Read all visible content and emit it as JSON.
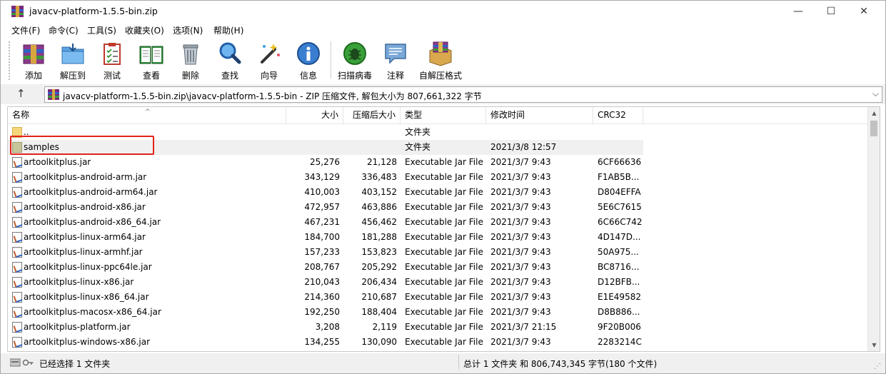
{
  "window": {
    "title": "javacv-platform-1.5.5-bin.zip",
    "minimize_glyph": "—",
    "maximize_glyph": "☐",
    "close_glyph": "✕"
  },
  "menu": [
    {
      "label": "文件(F)"
    },
    {
      "label": "命令(C)"
    },
    {
      "label": "工具(S)"
    },
    {
      "label": "收藏夹(O)"
    },
    {
      "label": "选项(N)"
    },
    {
      "label": "帮助(H)"
    }
  ],
  "toolbar": [
    {
      "label": "添加",
      "icon": "add-archive-icon"
    },
    {
      "label": "解压到",
      "icon": "extract-folder-icon"
    },
    {
      "label": "测试",
      "icon": "test-clipboard-icon"
    },
    {
      "label": "查看",
      "icon": "view-book-icon"
    },
    {
      "label": "删除",
      "icon": "trash-icon"
    },
    {
      "label": "查找",
      "icon": "magnifier-icon"
    },
    {
      "label": "向导",
      "icon": "wizard-wand-icon"
    },
    {
      "label": "信息",
      "icon": "info-icon"
    },
    {
      "label": "扫描病毒",
      "icon": "virus-scan-icon"
    },
    {
      "label": "注释",
      "icon": "comment-icon"
    },
    {
      "label": "自解压格式",
      "icon": "sfx-box-icon"
    }
  ],
  "address": {
    "path": "javacv-platform-1.5.5-bin.zip\\javacv-platform-1.5.5-bin - ZIP 压缩文件, 解包大小为 807,661,322 字节",
    "up_glyph": "↑",
    "dropdown_glyph": "⌵"
  },
  "columns": {
    "name": "名称",
    "size": "大小",
    "packed": "压缩后大小",
    "type": "类型",
    "modified": "修改时间",
    "crc": "CRC32"
  },
  "files": [
    {
      "name": "..",
      "size": "",
      "packed": "",
      "type": "文件夹",
      "modified": "",
      "crc": "",
      "kind": "folder"
    },
    {
      "name": "samples",
      "size": "",
      "packed": "",
      "type": "文件夹",
      "modified": "2021/3/8 12:57",
      "crc": "",
      "kind": "folder-selected"
    },
    {
      "name": "artoolkitplus.jar",
      "size": "25,276",
      "packed": "21,128",
      "type": "Executable Jar File",
      "modified": "2021/3/7 9:43",
      "crc": "6CF66636",
      "kind": "jar"
    },
    {
      "name": "artoolkitplus-android-arm.jar",
      "size": "343,129",
      "packed": "336,483",
      "type": "Executable Jar File",
      "modified": "2021/3/7 9:43",
      "crc": "F1AB5B...",
      "kind": "jar"
    },
    {
      "name": "artoolkitplus-android-arm64.jar",
      "size": "410,003",
      "packed": "403,152",
      "type": "Executable Jar File",
      "modified": "2021/3/7 9:43",
      "crc": "D804EFFA",
      "kind": "jar"
    },
    {
      "name": "artoolkitplus-android-x86.jar",
      "size": "472,957",
      "packed": "463,886",
      "type": "Executable Jar File",
      "modified": "2021/3/7 9:43",
      "crc": "5E6C7615",
      "kind": "jar"
    },
    {
      "name": "artoolkitplus-android-x86_64.jar",
      "size": "467,231",
      "packed": "456,462",
      "type": "Executable Jar File",
      "modified": "2021/3/7 9:43",
      "crc": "6C66C742",
      "kind": "jar"
    },
    {
      "name": "artoolkitplus-linux-arm64.jar",
      "size": "184,700",
      "packed": "181,288",
      "type": "Executable Jar File",
      "modified": "2021/3/7 9:43",
      "crc": "4D147D...",
      "kind": "jar"
    },
    {
      "name": "artoolkitplus-linux-armhf.jar",
      "size": "157,233",
      "packed": "153,823",
      "type": "Executable Jar File",
      "modified": "2021/3/7 9:43",
      "crc": "50A975...",
      "kind": "jar"
    },
    {
      "name": "artoolkitplus-linux-ppc64le.jar",
      "size": "208,767",
      "packed": "205,292",
      "type": "Executable Jar File",
      "modified": "2021/3/7 9:43",
      "crc": "BC8716...",
      "kind": "jar"
    },
    {
      "name": "artoolkitplus-linux-x86.jar",
      "size": "210,043",
      "packed": "206,434",
      "type": "Executable Jar File",
      "modified": "2021/3/7 9:43",
      "crc": "D12BFB...",
      "kind": "jar"
    },
    {
      "name": "artoolkitplus-linux-x86_64.jar",
      "size": "214,360",
      "packed": "210,687",
      "type": "Executable Jar File",
      "modified": "2021/3/7 9:43",
      "crc": "E1E49582",
      "kind": "jar"
    },
    {
      "name": "artoolkitplus-macosx-x86_64.jar",
      "size": "192,250",
      "packed": "188,404",
      "type": "Executable Jar File",
      "modified": "2021/3/7 9:43",
      "crc": "D8B886...",
      "kind": "jar"
    },
    {
      "name": "artoolkitplus-platform.jar",
      "size": "3,208",
      "packed": "2,119",
      "type": "Executable Jar File",
      "modified": "2021/3/7 21:15",
      "crc": "9F20B006",
      "kind": "jar"
    },
    {
      "name": "artoolkitplus-windows-x86.jar",
      "size": "134,255",
      "packed": "130,090",
      "type": "Executable Jar File",
      "modified": "2021/3/7 9:43",
      "crc": "2283214C",
      "kind": "jar"
    }
  ],
  "status": {
    "left": "已经选择 1 文件夹",
    "right": "总计 1 文件夹 和 806,743,345 字节(180 个文件)"
  },
  "colors": {
    "highlight_border": "#e2231a",
    "selected_row": "#f0f0f0"
  }
}
